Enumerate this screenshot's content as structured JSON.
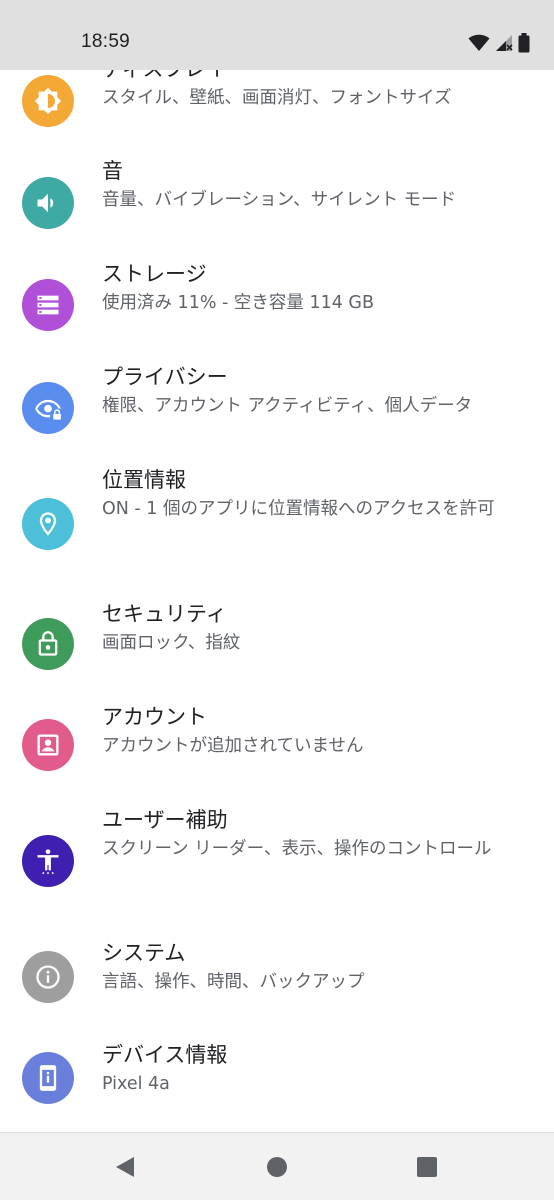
{
  "status_bar": {
    "time": "18:59",
    "icons": [
      "wifi-icon",
      "signal-off-icon",
      "battery-icon"
    ]
  },
  "settings": [
    {
      "title": "ディスプレイ",
      "summary": "スタイル、壁紙、画面消灯、フォントサイズ",
      "icon": "brightness-icon",
      "color": "#f4a835"
    },
    {
      "title": "音",
      "summary": "音量、バイブレーション、サイレント モード",
      "icon": "volume-icon",
      "color": "#3fa9a4"
    },
    {
      "title": "ストレージ",
      "summary": "使用済み 11% - 空き容量 114 GB",
      "icon": "storage-icon",
      "color": "#b04fd8"
    },
    {
      "title": "プライバシー",
      "summary": "権限、アカウント アクティビティ、個人データ",
      "icon": "privacy-eye-icon",
      "color": "#5b8def"
    },
    {
      "title": "位置情報",
      "summary": "ON - 1 個のアプリに位置情報へのアクセスを許可",
      "icon": "location-pin-icon",
      "color": "#4dbfd9"
    },
    {
      "title": "セキュリティ",
      "summary": "画面ロック、指紋",
      "icon": "lock-icon",
      "color": "#3f9b5a"
    },
    {
      "title": "アカウント",
      "summary": "アカウントが追加されていません",
      "icon": "account-box-icon",
      "color": "#e25c8b"
    },
    {
      "title": "ユーザー補助",
      "summary": "スクリーン リーダー、表示、操作のコントロール",
      "icon": "accessibility-icon",
      "color": "#3f1fb0"
    },
    {
      "title": "システム",
      "summary": "言語、操作、時間、バックアップ",
      "icon": "info-icon",
      "color": "#9e9e9e"
    },
    {
      "title": "デバイス情報",
      "summary": "Pixel 4a",
      "icon": "phone-info-icon",
      "color": "#6a7fdb"
    }
  ],
  "nav_bar": {
    "buttons": [
      "back-icon",
      "home-icon",
      "recents-icon"
    ]
  }
}
